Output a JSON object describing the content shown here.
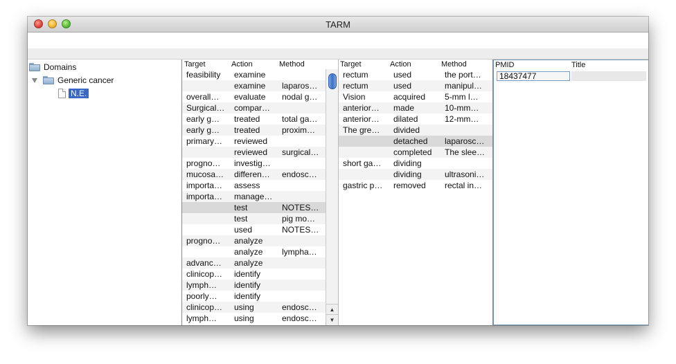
{
  "window": {
    "title": "TARM"
  },
  "tree": {
    "root": "Domains",
    "child": "Generic cancer",
    "leaf": "N.E."
  },
  "table1": {
    "headers": [
      "Target",
      "Action",
      "Method"
    ],
    "rows": [
      [
        "feasibility",
        "examine",
        ""
      ],
      [
        "",
        "examine",
        "laparos…"
      ],
      [
        "overall…",
        "evaluate",
        "nodal g…"
      ],
      [
        "Surgical…",
        "compar…",
        ""
      ],
      [
        "early g…",
        "treated",
        "total ga…"
      ],
      [
        "early g…",
        "treated",
        "proxim…"
      ],
      [
        "primary…",
        "reviewed",
        ""
      ],
      [
        "",
        "reviewed",
        "surgical…"
      ],
      [
        "progno…",
        "investig…",
        ""
      ],
      [
        "mucosa…",
        "differen…",
        "endosc…"
      ],
      [
        "importa…",
        "assess",
        ""
      ],
      [
        "importa…",
        "manage…",
        ""
      ],
      [
        "",
        "test",
        "NOTES…"
      ],
      [
        "",
        "test",
        "pig mo…"
      ],
      [
        "",
        "used",
        "NOTES…"
      ],
      [
        "progno…",
        "analyze",
        ""
      ],
      [
        "",
        "analyze",
        "lympha…"
      ],
      [
        "advanc…",
        "analyze",
        ""
      ],
      [
        "clinicop…",
        "identify",
        ""
      ],
      [
        "lymph…",
        "identify",
        ""
      ],
      [
        "poorly…",
        "identify",
        ""
      ],
      [
        "clinicop…",
        "using",
        "endosc…"
      ],
      [
        "lymph…",
        "using",
        "endosc…"
      ]
    ]
  },
  "table2": {
    "headers": [
      "Target",
      "Action",
      "Method"
    ],
    "rows": [
      [
        "rectum",
        "used",
        "the port…"
      ],
      [
        "rectum",
        "used",
        "manipul…"
      ],
      [
        "Vision",
        "acquired",
        "5-mm l…"
      ],
      [
        "anterior…",
        "made",
        "10-mm…"
      ],
      [
        "anterior…",
        "dilated",
        "12-mm…"
      ],
      [
        "The gre…",
        "divided",
        ""
      ],
      [
        "",
        "detached",
        "laparosc…"
      ],
      [
        "",
        "completed",
        "The slee…"
      ],
      [
        "short ga…",
        "dividing",
        ""
      ],
      [
        "",
        "dividing",
        "ultrasoni…"
      ],
      [
        "gastric p…",
        "removed",
        "rectal in…"
      ]
    ]
  },
  "table3": {
    "headers": [
      "PMID",
      "Title"
    ],
    "rows": [
      [
        "18437477",
        ""
      ]
    ]
  },
  "scrollbar": {
    "up_icon": "arrow-up-icon",
    "down_icon": "arrow-down-icon"
  }
}
